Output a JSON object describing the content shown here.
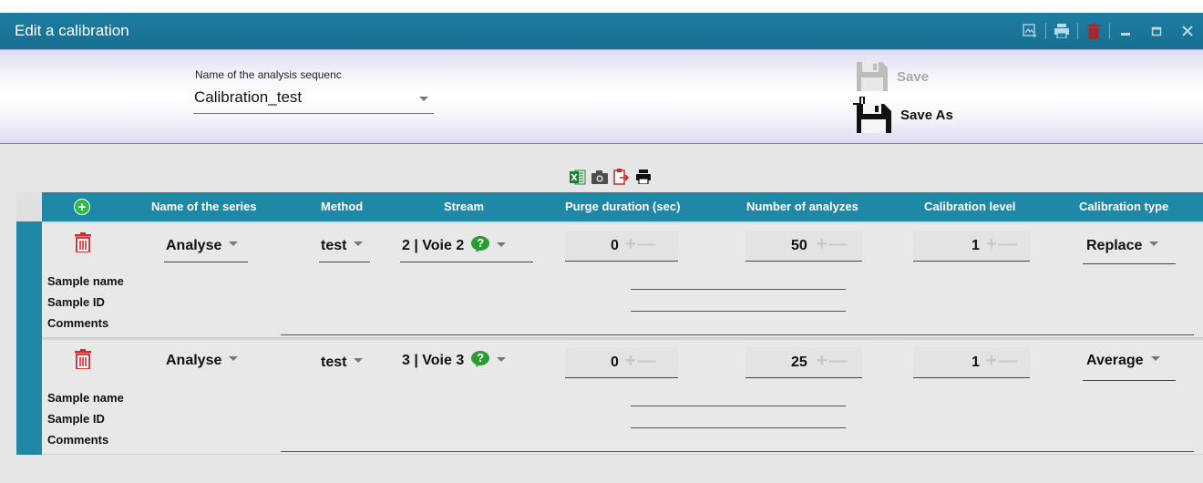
{
  "window": {
    "title": "Edit a calibration"
  },
  "header": {
    "sequence_label": "Name of the analysis sequenc",
    "sequence_value": "Calibration_test",
    "save_label": "Save",
    "save_as_label": "Save As"
  },
  "columns": {
    "name": "Name of the series",
    "method": "Method",
    "stream": "Stream",
    "purge": "Purge duration (sec)",
    "analyzes": "Number of analyzes",
    "level": "Calibration level",
    "type": "Calibration type"
  },
  "sample_labels": {
    "sample_name": "Sample name",
    "sample_id": "Sample ID",
    "comments": "Comments"
  },
  "rows": [
    {
      "series": "Analyse",
      "method": "test",
      "stream": "2 | Voie 2",
      "purge": "0",
      "analyzes": "50",
      "level": "1",
      "type": "Replace"
    },
    {
      "series": "Analyse",
      "method": "test",
      "stream": "3 | Voie 3",
      "purge": "0",
      "analyzes": "25",
      "level": "1",
      "type": "Average"
    }
  ],
  "colors": {
    "accent": "#1e88a6",
    "title_bar": "#1d7ea2",
    "delete_red": "#d8262a",
    "help_green": "#2a9a33",
    "add_green": "#2fb84a"
  },
  "icons": {
    "toolbar": [
      "excel-icon",
      "camera-icon",
      "export-icon",
      "print-icon"
    ],
    "window": [
      "export-image-icon",
      "print-icon",
      "delete-icon",
      "minimize-icon",
      "maximize-icon",
      "close-icon"
    ]
  }
}
